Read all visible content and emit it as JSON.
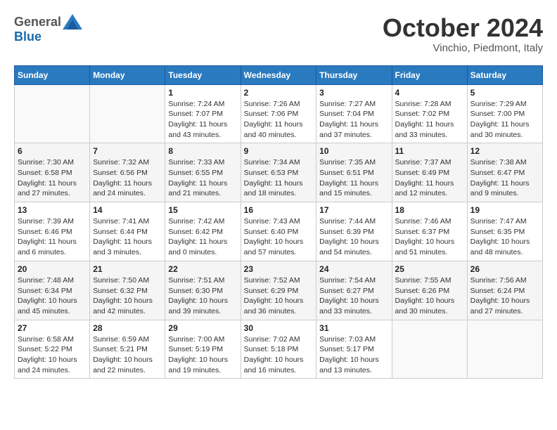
{
  "header": {
    "logo_general": "General",
    "logo_blue": "Blue",
    "month_title": "October 2024",
    "subtitle": "Vinchio, Piedmont, Italy"
  },
  "columns": [
    "Sunday",
    "Monday",
    "Tuesday",
    "Wednesday",
    "Thursday",
    "Friday",
    "Saturday"
  ],
  "weeks": [
    [
      {
        "day": "",
        "detail": ""
      },
      {
        "day": "",
        "detail": ""
      },
      {
        "day": "1",
        "detail": "Sunrise: 7:24 AM\nSunset: 7:07 PM\nDaylight: 11 hours and 43 minutes."
      },
      {
        "day": "2",
        "detail": "Sunrise: 7:26 AM\nSunset: 7:06 PM\nDaylight: 11 hours and 40 minutes."
      },
      {
        "day": "3",
        "detail": "Sunrise: 7:27 AM\nSunset: 7:04 PM\nDaylight: 11 hours and 37 minutes."
      },
      {
        "day": "4",
        "detail": "Sunrise: 7:28 AM\nSunset: 7:02 PM\nDaylight: 11 hours and 33 minutes."
      },
      {
        "day": "5",
        "detail": "Sunrise: 7:29 AM\nSunset: 7:00 PM\nDaylight: 11 hours and 30 minutes."
      }
    ],
    [
      {
        "day": "6",
        "detail": "Sunrise: 7:30 AM\nSunset: 6:58 PM\nDaylight: 11 hours and 27 minutes."
      },
      {
        "day": "7",
        "detail": "Sunrise: 7:32 AM\nSunset: 6:56 PM\nDaylight: 11 hours and 24 minutes."
      },
      {
        "day": "8",
        "detail": "Sunrise: 7:33 AM\nSunset: 6:55 PM\nDaylight: 11 hours and 21 minutes."
      },
      {
        "day": "9",
        "detail": "Sunrise: 7:34 AM\nSunset: 6:53 PM\nDaylight: 11 hours and 18 minutes."
      },
      {
        "day": "10",
        "detail": "Sunrise: 7:35 AM\nSunset: 6:51 PM\nDaylight: 11 hours and 15 minutes."
      },
      {
        "day": "11",
        "detail": "Sunrise: 7:37 AM\nSunset: 6:49 PM\nDaylight: 11 hours and 12 minutes."
      },
      {
        "day": "12",
        "detail": "Sunrise: 7:38 AM\nSunset: 6:47 PM\nDaylight: 11 hours and 9 minutes."
      }
    ],
    [
      {
        "day": "13",
        "detail": "Sunrise: 7:39 AM\nSunset: 6:46 PM\nDaylight: 11 hours and 6 minutes."
      },
      {
        "day": "14",
        "detail": "Sunrise: 7:41 AM\nSunset: 6:44 PM\nDaylight: 11 hours and 3 minutes."
      },
      {
        "day": "15",
        "detail": "Sunrise: 7:42 AM\nSunset: 6:42 PM\nDaylight: 11 hours and 0 minutes."
      },
      {
        "day": "16",
        "detail": "Sunrise: 7:43 AM\nSunset: 6:40 PM\nDaylight: 10 hours and 57 minutes."
      },
      {
        "day": "17",
        "detail": "Sunrise: 7:44 AM\nSunset: 6:39 PM\nDaylight: 10 hours and 54 minutes."
      },
      {
        "day": "18",
        "detail": "Sunrise: 7:46 AM\nSunset: 6:37 PM\nDaylight: 10 hours and 51 minutes."
      },
      {
        "day": "19",
        "detail": "Sunrise: 7:47 AM\nSunset: 6:35 PM\nDaylight: 10 hours and 48 minutes."
      }
    ],
    [
      {
        "day": "20",
        "detail": "Sunrise: 7:48 AM\nSunset: 6:34 PM\nDaylight: 10 hours and 45 minutes."
      },
      {
        "day": "21",
        "detail": "Sunrise: 7:50 AM\nSunset: 6:32 PM\nDaylight: 10 hours and 42 minutes."
      },
      {
        "day": "22",
        "detail": "Sunrise: 7:51 AM\nSunset: 6:30 PM\nDaylight: 10 hours and 39 minutes."
      },
      {
        "day": "23",
        "detail": "Sunrise: 7:52 AM\nSunset: 6:29 PM\nDaylight: 10 hours and 36 minutes."
      },
      {
        "day": "24",
        "detail": "Sunrise: 7:54 AM\nSunset: 6:27 PM\nDaylight: 10 hours and 33 minutes."
      },
      {
        "day": "25",
        "detail": "Sunrise: 7:55 AM\nSunset: 6:26 PM\nDaylight: 10 hours and 30 minutes."
      },
      {
        "day": "26",
        "detail": "Sunrise: 7:56 AM\nSunset: 6:24 PM\nDaylight: 10 hours and 27 minutes."
      }
    ],
    [
      {
        "day": "27",
        "detail": "Sunrise: 6:58 AM\nSunset: 5:22 PM\nDaylight: 10 hours and 24 minutes."
      },
      {
        "day": "28",
        "detail": "Sunrise: 6:59 AM\nSunset: 5:21 PM\nDaylight: 10 hours and 22 minutes."
      },
      {
        "day": "29",
        "detail": "Sunrise: 7:00 AM\nSunset: 5:19 PM\nDaylight: 10 hours and 19 minutes."
      },
      {
        "day": "30",
        "detail": "Sunrise: 7:02 AM\nSunset: 5:18 PM\nDaylight: 10 hours and 16 minutes."
      },
      {
        "day": "31",
        "detail": "Sunrise: 7:03 AM\nSunset: 5:17 PM\nDaylight: 10 hours and 13 minutes."
      },
      {
        "day": "",
        "detail": ""
      },
      {
        "day": "",
        "detail": ""
      }
    ]
  ]
}
